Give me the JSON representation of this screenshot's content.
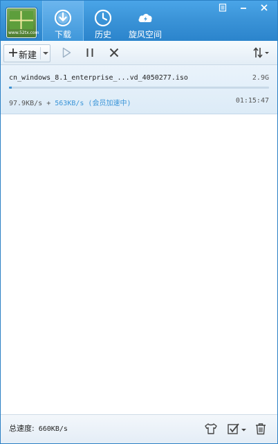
{
  "app": {
    "logo_icon": "app-logo-icon",
    "logo_text": "www.52tx.com"
  },
  "nav": {
    "tabs": [
      {
        "label": "下载",
        "icon": "download-icon",
        "active": true
      },
      {
        "label": "历史",
        "icon": "clock-icon",
        "active": false
      },
      {
        "label": "旋风空间",
        "icon": "cloud-icon",
        "active": false
      }
    ]
  },
  "window_controls": [
    "menu-icon",
    "minimize-icon",
    "close-icon"
  ],
  "toolbar": {
    "new_label": "新建",
    "icons": [
      "plus-icon",
      "dropdown-caret-icon",
      "play-icon",
      "pause-icon",
      "stop-icon",
      "sort-icon"
    ]
  },
  "task": {
    "filename": "cn_windows_8.1_enterprise_...vd_4050277.iso",
    "size": "2.9G",
    "progress_percent": 1,
    "speed": "97.9KB/s",
    "plus": "+",
    "vip_speed": "563KB/s (会员加速中)",
    "remaining": "01:15:47"
  },
  "status": {
    "total_speed_label": "总速度:",
    "total_speed_value": "660KB/s",
    "icons": [
      "skin-icon",
      "batch-select-icon",
      "trash-icon"
    ]
  },
  "colors": {
    "header": "#3b94d8",
    "accent": "#3b95d8",
    "task_bg": "#e2eef8"
  }
}
